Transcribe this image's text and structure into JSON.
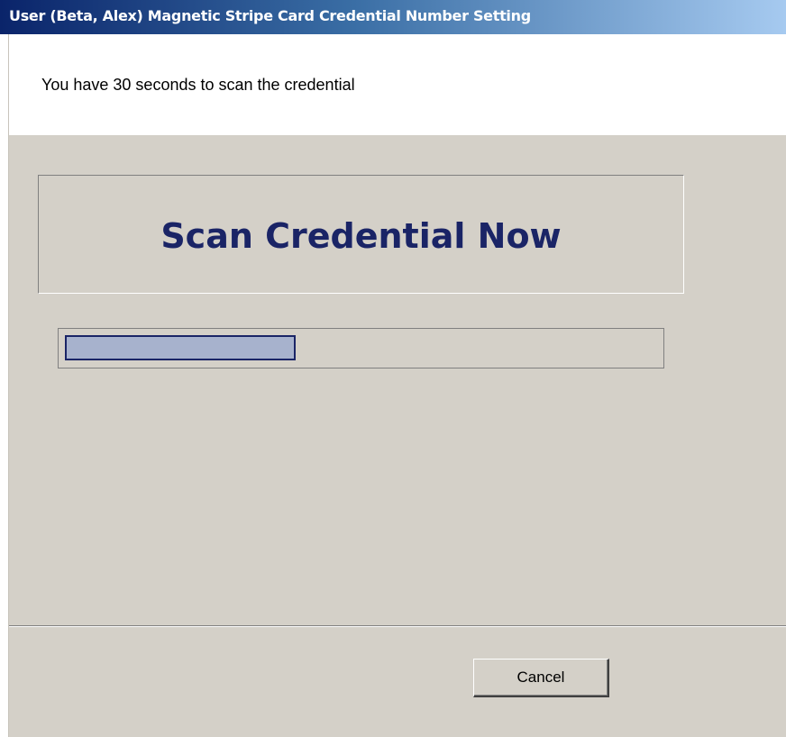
{
  "window": {
    "title": "User (Beta, Alex) Magnetic Stripe Card Credential Number Setting"
  },
  "header": {
    "instruction": "You have 30 seconds to scan the credential"
  },
  "main": {
    "scan_prompt": "Scan Credential Now",
    "progress_percent": 39
  },
  "footer": {
    "cancel_label": "Cancel"
  },
  "colors": {
    "title_bar_start": "#0a246a",
    "title_bar_end": "#a6caf0",
    "dialog_background": "#d4d0c8",
    "scan_prompt_text": "#1a2466",
    "progress_fill": "#a7b2cd",
    "progress_border": "#1a2466"
  }
}
